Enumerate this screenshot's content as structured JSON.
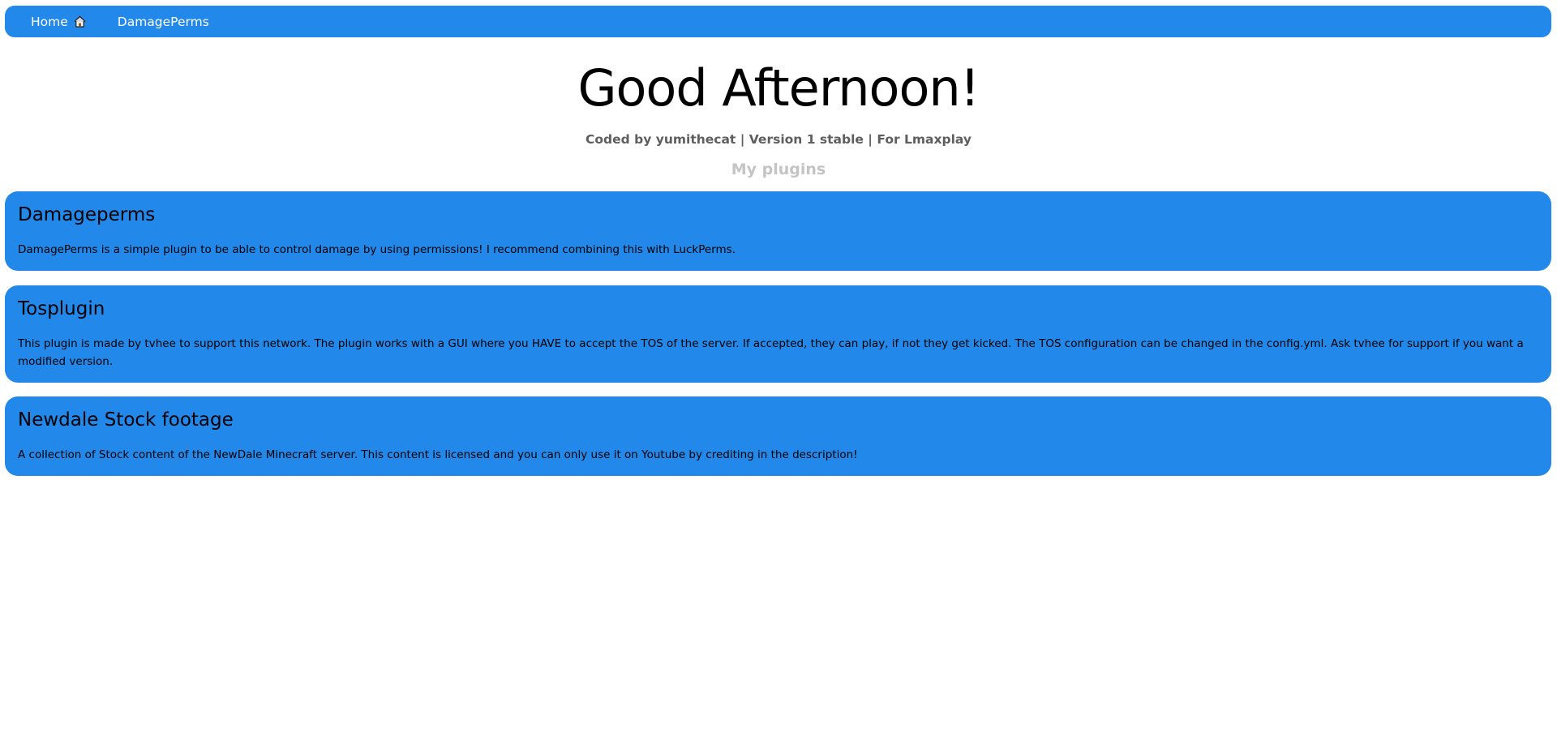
{
  "nav": {
    "items": [
      {
        "label": "Home",
        "icon": "home-icon"
      },
      {
        "label": "DamagePerms"
      }
    ]
  },
  "header": {
    "greeting": "Good Afternoon!",
    "credits": "Coded by yumithecat | Version 1 stable | For Lmaxplay",
    "section_title": "My plugins"
  },
  "plugins": [
    {
      "title": "Damageperms",
      "description": "DamagePerms is a simple plugin to be able to control damage by using permissions! I recommend combining this with LuckPerms."
    },
    {
      "title": "Tosplugin",
      "description": "This plugin is made by tvhee to support this network. The plugin works with a GUI where you HAVE to accept the TOS of the server. If accepted, they can play, if not they get kicked. The TOS configuration can be changed in the config.yml. Ask tvhee for support if you want a modified version."
    },
    {
      "title": "Newdale Stock footage",
      "description": "A collection of Stock content of the NewDale Minecraft server. This content is licensed and you can only use it on Youtube by crediting in the description!"
    }
  ],
  "colors": {
    "accent": "#2288ea",
    "credits_text": "#5e5e5e",
    "section_title_text": "#c4c4c4"
  }
}
